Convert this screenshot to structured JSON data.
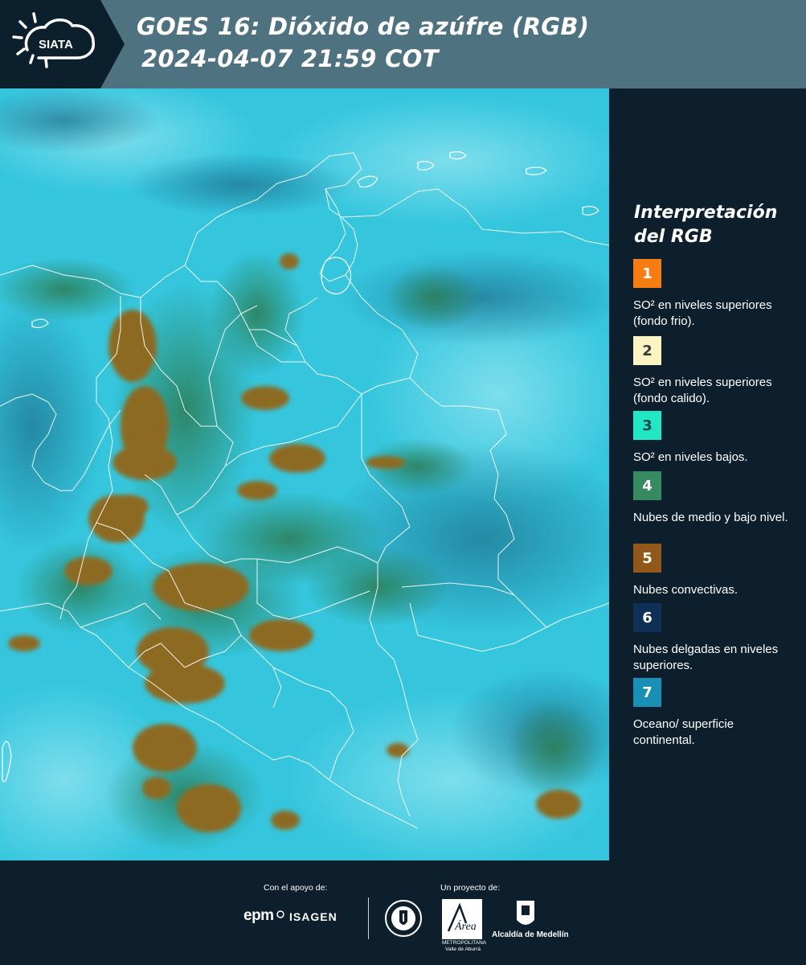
{
  "header": {
    "logo_text": "SIATA",
    "title_line1": "GOES 16: Dióxido de azúfre (RGB)",
    "title_line2": "2024-04-07 21:59 COT"
  },
  "legend": {
    "title": "Interpretación del RGB",
    "items": [
      {
        "number": "1",
        "color": "#f57d12",
        "text_color": "#ffffff",
        "label": "SO² en niveles superiores (fondo frio)."
      },
      {
        "number": "2",
        "color": "#fcf4c2",
        "text_color": "#3a3a3a",
        "label": "SO² en niveles superiores (fondo calido)."
      },
      {
        "number": "3",
        "color": "#21e7c4",
        "text_color": "#1c4a4a",
        "label": "SO² en niveles bajos."
      },
      {
        "number": "4",
        "color": "#358a5f",
        "text_color": "#ffffff",
        "label": "Nubes de medio y bajo nivel."
      },
      {
        "number": "5",
        "color": "#91581a",
        "text_color": "#ffffff",
        "label": "Nubes convectivas."
      },
      {
        "number": "6",
        "color": "#102f56",
        "text_color": "#ffffff",
        "label": "Nubes delgadas en niveles superiores."
      },
      {
        "number": "7",
        "color": "#1a8fb6",
        "text_color": "#ffffff",
        "label": "Oceano/ superficie continental."
      }
    ]
  },
  "footer": {
    "support_label": "Con el apoyo de:",
    "project_label": "Un proyecto de:",
    "epm": "epm",
    "isagen": "ISAGEN",
    "area_name": "Área",
    "area_subtitle": "METROPOLITANA Valle de Aburrá",
    "alcaldia": "Alcaldía de Medellín"
  },
  "colors": {
    "background": "#0d1f2c",
    "header_band": "#4f7280",
    "map_cyan": "#34c8e0",
    "convective": "#8d6a22",
    "midlevel": "#2f8a55",
    "borders": "#ffffff"
  }
}
